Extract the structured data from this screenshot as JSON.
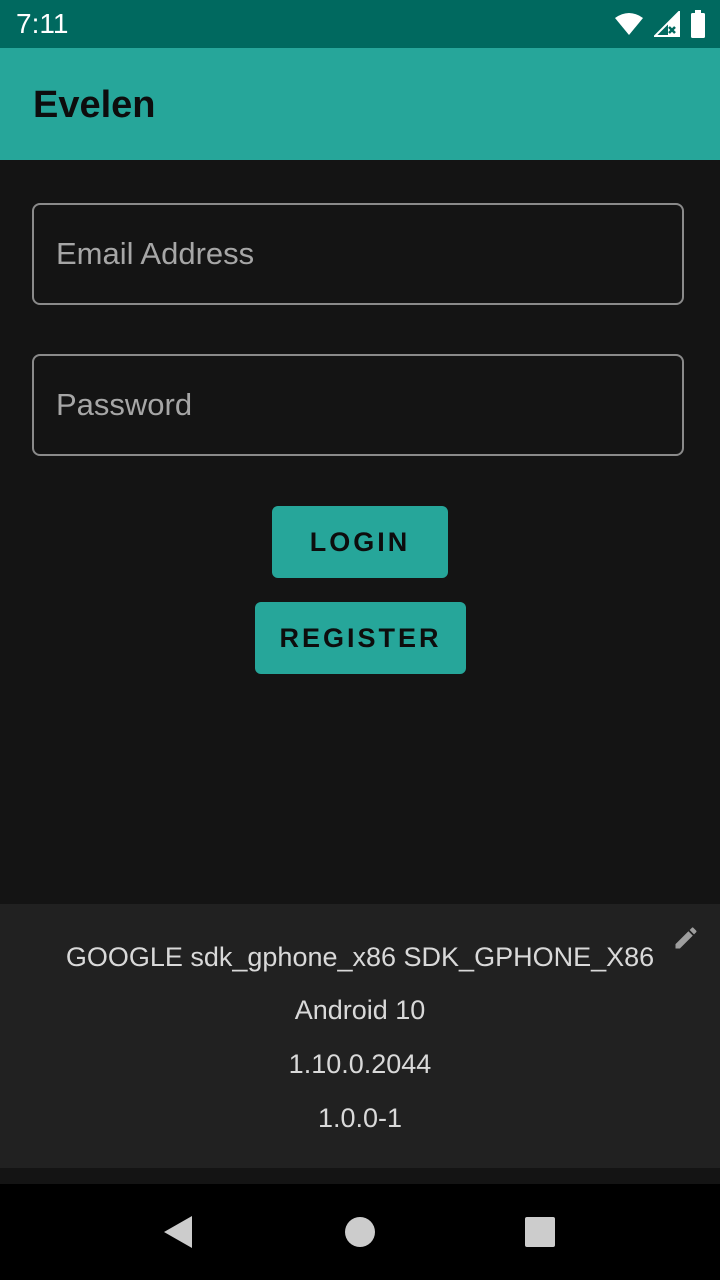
{
  "status_bar": {
    "time": "7:11",
    "icons": [
      "wifi-icon",
      "signal-icon",
      "battery-icon"
    ]
  },
  "app_bar": {
    "title": "Evelen",
    "color": "#26a69a"
  },
  "form": {
    "email_placeholder": "Email Address",
    "email_value": "",
    "password_placeholder": "Password",
    "password_value": "",
    "login_label": "LOGIN",
    "register_label": "REGISTER"
  },
  "info": {
    "device": "GOOGLE sdk_gphone_x86 SDK_GPHONE_X86",
    "android": "Android 10",
    "build": "1.10.0.2044",
    "version": "1.0.0-1",
    "edit_icon": "pencil-icon"
  },
  "nav": {
    "icons": [
      "back-icon",
      "home-icon",
      "recents-icon"
    ]
  },
  "colors": {
    "status_bar": "#00695f",
    "accent": "#26a69a",
    "background": "#141414",
    "info_panel": "#212121"
  }
}
